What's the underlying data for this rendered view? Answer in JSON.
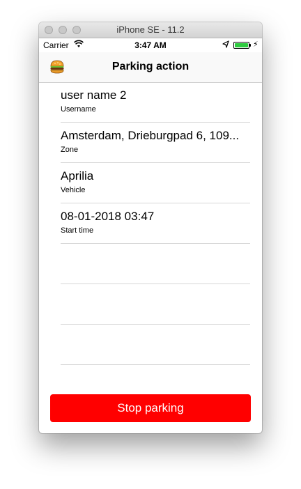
{
  "window": {
    "title": "iPhone SE - 11.2"
  },
  "status_bar": {
    "carrier": "Carrier",
    "time": "3:47 AM",
    "battery_color": "#2ecc40"
  },
  "nav": {
    "title": "Parking action",
    "menu_icon": "burger-icon"
  },
  "fields": [
    {
      "value": "user name 2",
      "label": "Username"
    },
    {
      "value": "Amsterdam, Drieburgpad 6, 109...",
      "label": "Zone"
    },
    {
      "value": "Aprilia",
      "label": "Vehicle"
    },
    {
      "value": "08-01-2018 03:47",
      "label": "Start time"
    },
    {
      "value": "",
      "label": ""
    },
    {
      "value": "",
      "label": ""
    },
    {
      "value": "",
      "label": ""
    }
  ],
  "actions": {
    "stop_label": "Stop parking",
    "stop_color": "#ff0000"
  }
}
